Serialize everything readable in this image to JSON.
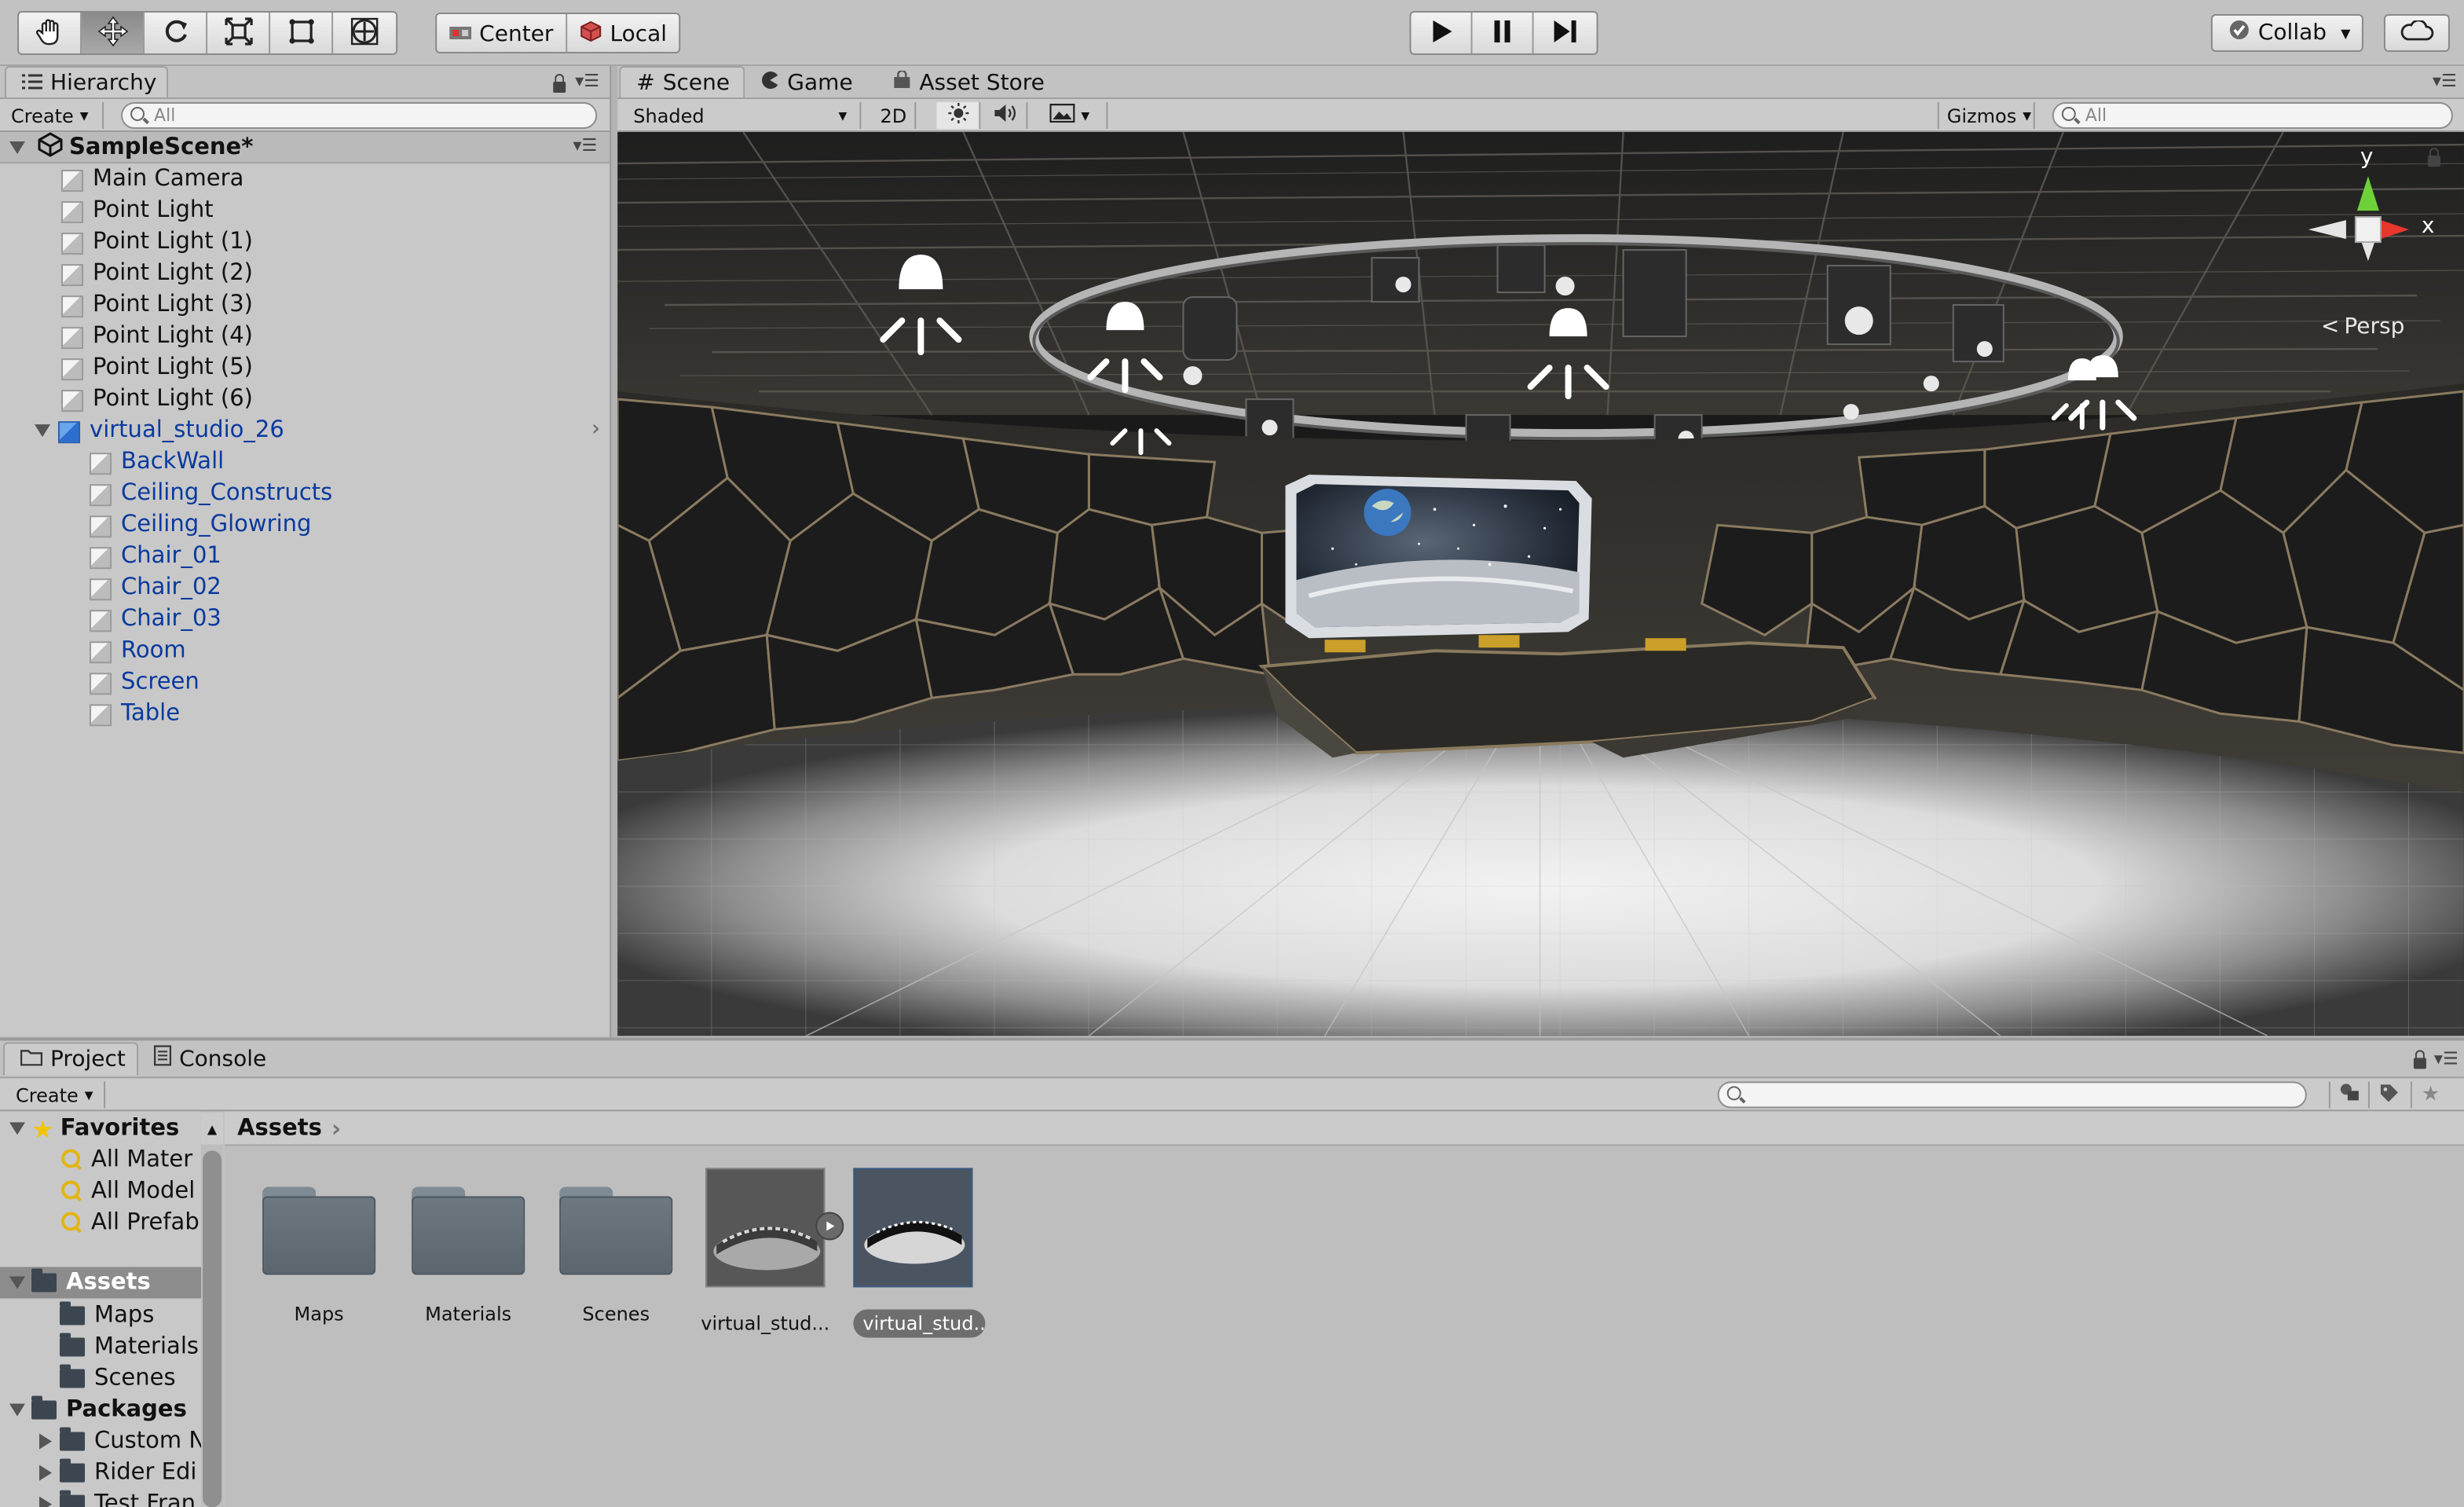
{
  "toolbar": {
    "tools": [
      {
        "name": "hand-tool",
        "icon": "hand-icon"
      },
      {
        "name": "move-tool",
        "icon": "move-icon",
        "active": true
      },
      {
        "name": "rotate-tool",
        "icon": "rotate-icon"
      },
      {
        "name": "scale-tool",
        "icon": "scale-icon"
      },
      {
        "name": "rect-tool",
        "icon": "rect-icon"
      },
      {
        "name": "transform-tool",
        "icon": "transform-icon"
      }
    ],
    "pivot_label": "Center",
    "space_label": "Local",
    "collab_label": "Collab"
  },
  "hierarchy": {
    "tab_label": "Hierarchy",
    "create_label": "Create",
    "search_placeholder": "All",
    "scene_name": "SampleScene*",
    "items": [
      "Main Camera",
      "Point Light",
      "Point Light (1)",
      "Point Light (2)",
      "Point Light (3)",
      "Point Light (4)",
      "Point Light (5)",
      "Point Light (6)"
    ],
    "prefab": {
      "name": "virtual_studio_26",
      "children": [
        "BackWall",
        "Ceiling_Constructs",
        "Ceiling_Glowring",
        "Chair_01",
        "Chair_02",
        "Chair_03",
        "Room",
        "Screen",
        "Table"
      ]
    }
  },
  "scene_tabs": {
    "scene": "Scene",
    "game": "Game",
    "asset_store": "Asset Store"
  },
  "scene_toolbar": {
    "shading_mode": "Shaded",
    "mode_2d": "2D",
    "gizmos_label": "Gizmos",
    "search_placeholder": "All"
  },
  "gizmo": {
    "y_label": "y",
    "x_label": "x",
    "projection": "Persp"
  },
  "project": {
    "tab_label": "Project",
    "console_label": "Console",
    "create_label": "Create",
    "favorites_label": "Favorites",
    "favorites": [
      "All Mater",
      "All Model",
      "All Prefab"
    ],
    "assets_label": "Assets",
    "asset_folders": [
      "Maps",
      "Materials",
      "Scenes"
    ],
    "packages_label": "Packages",
    "packages": [
      "Custom N",
      "Rider Edi",
      "Test Fran"
    ],
    "breadcrumb": "Assets",
    "grid_items": [
      {
        "label": "Maps",
        "kind": "folder"
      },
      {
        "label": "Materials",
        "kind": "folder"
      },
      {
        "label": "Scenes",
        "kind": "folder"
      },
      {
        "label": "virtual_stud...",
        "kind": "model"
      },
      {
        "label": "virtual_stud...",
        "kind": "prefab",
        "selected": true
      }
    ]
  },
  "colors": {
    "panel_bg": "#c2c2c2",
    "selection_blue": "#0a3a9e",
    "gizmo_y": "#6fd13a",
    "gizmo_x": "#e8372c",
    "folder": "#5f6a72"
  }
}
